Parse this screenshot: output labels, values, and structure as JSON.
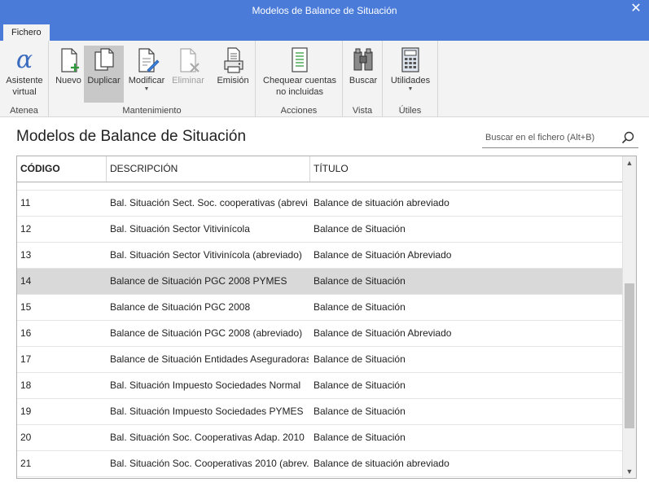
{
  "window": {
    "title": "Modelos de Balance de Situación",
    "close_glyph": "✕"
  },
  "tabs": [
    {
      "label": "Fichero"
    }
  ],
  "ribbon": {
    "groups": {
      "atenea": {
        "label": "Atenea",
        "buttons": {
          "asistente": {
            "label_line1": "Asistente",
            "label_line2": "virtual",
            "icon": "alpha-icon"
          }
        }
      },
      "mantenimiento": {
        "label": "Mantenimiento",
        "buttons": {
          "nuevo": {
            "label": "Nuevo",
            "icon": "new-document-icon"
          },
          "duplicar": {
            "label": "Duplicar",
            "icon": "duplicate-icon"
          },
          "modificar": {
            "label": "Modificar",
            "icon": "edit-document-icon"
          },
          "eliminar": {
            "label": "Eliminar",
            "icon": "delete-document-icon"
          },
          "emision": {
            "label": "Emisión",
            "icon": "print-icon"
          }
        }
      },
      "acciones": {
        "label": "Acciones",
        "buttons": {
          "chequear": {
            "label_line1": "Chequear cuentas",
            "label_line2": "no incluidas",
            "icon": "checklist-icon"
          }
        }
      },
      "vista": {
        "label": "Vista",
        "buttons": {
          "buscar": {
            "label": "Buscar",
            "icon": "binoculars-icon"
          }
        }
      },
      "utiles": {
        "label": "Útiles",
        "buttons": {
          "utilidades": {
            "label": "Utilidades",
            "icon": "calculator-icon"
          }
        }
      }
    }
  },
  "page": {
    "title": "Modelos de Balance de Situación"
  },
  "search": {
    "placeholder": "Buscar en el fichero (Alt+B)"
  },
  "grid": {
    "headers": {
      "codigo": "CÓDIGO",
      "descripcion": "DESCRIPCIÓN",
      "titulo": "TÍTULO"
    },
    "rows": [
      {
        "codigo": "11",
        "descripcion": "Bal. Situación Sect. Soc. cooperativas (abrevi...",
        "titulo": "Balance de situación abreviado"
      },
      {
        "codigo": "12",
        "descripcion": "Bal. Situación Sector Vitivinícola",
        "titulo": "Balance de Situación"
      },
      {
        "codigo": "13",
        "descripcion": "Bal. Situación Sector Vitivinícola (abreviado)",
        "titulo": "Balance de Situación Abreviado"
      },
      {
        "codigo": "14",
        "descripcion": "Balance de Situación PGC 2008 PYMES",
        "titulo": "Balance de Situación"
      },
      {
        "codigo": "15",
        "descripcion": "Balance de Situación PGC 2008",
        "titulo": "Balance de Situación"
      },
      {
        "codigo": "16",
        "descripcion": "Balance de Situación PGC 2008 (abreviado)",
        "titulo": "Balance de Situación Abreviado"
      },
      {
        "codigo": "17",
        "descripcion": "Balance de Situación Entidades Aseguradoras",
        "titulo": "Balance de Situación"
      },
      {
        "codigo": "18",
        "descripcion": "Bal. Situación  Impuesto Sociedades Normal",
        "titulo": "Balance de Situación"
      },
      {
        "codigo": "19",
        "descripcion": "Bal. Situación  Impuesto Sociedades PYMES",
        "titulo": "Balance de Situación"
      },
      {
        "codigo": "20",
        "descripcion": "Bal. Situación Soc. Cooperativas Adap. 2010",
        "titulo": "Balance de Situación"
      },
      {
        "codigo": "21",
        "descripcion": "Bal. Situación Soc. Cooperativas 2010 (abrev...",
        "titulo": "Balance de situación abreviado"
      }
    ],
    "selected_codigo": "14"
  },
  "colors": {
    "accent": "#4a7bd8",
    "selected_row": "#d9d9d9",
    "ribbon_bg": "#f3f3f3"
  }
}
